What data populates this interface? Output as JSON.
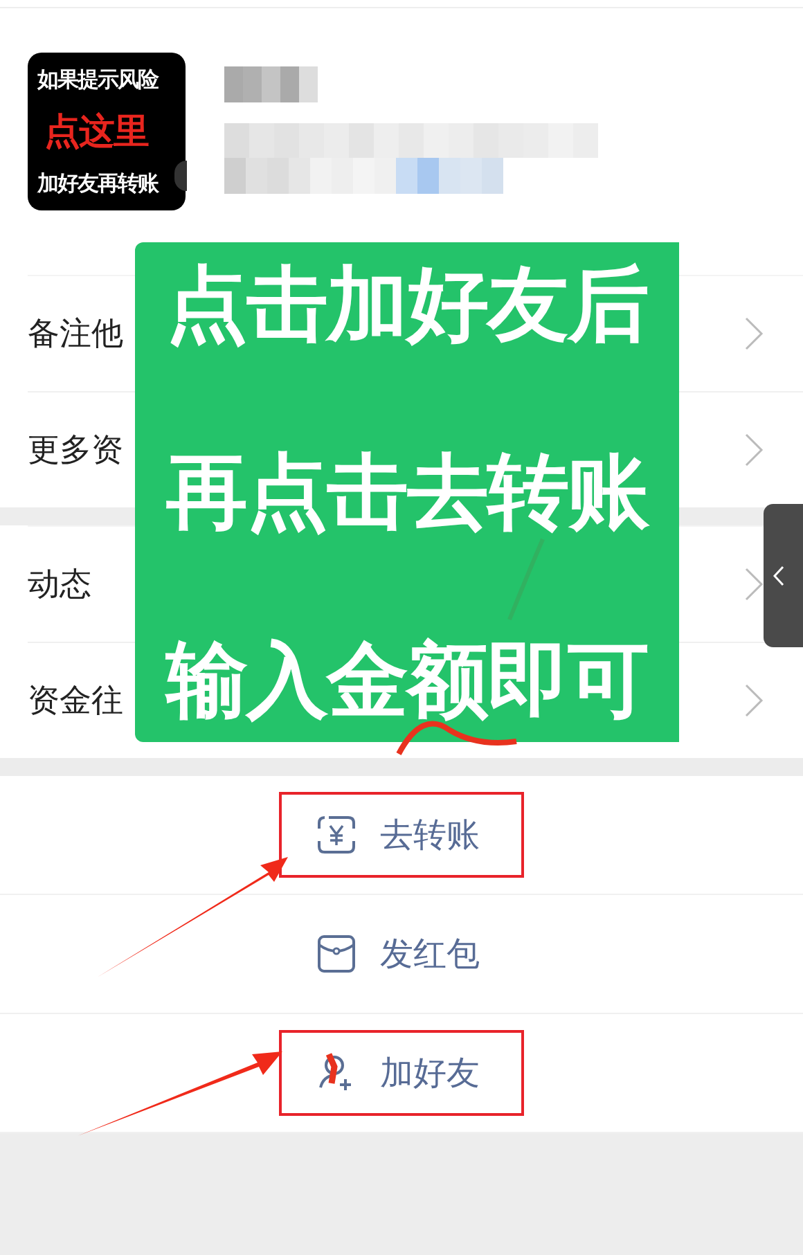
{
  "avatar_badge": {
    "lines": [
      {
        "text": "如果提示风险",
        "kind": "plain"
      },
      {
        "text": "点这里",
        "kind": "highlight"
      },
      {
        "text": "加好友再转账",
        "kind": "plain"
      }
    ]
  },
  "menu_groups": [
    [
      {
        "label": "备注他"
      },
      {
        "label": "更多资"
      }
    ],
    [
      {
        "label": "动态"
      },
      {
        "label": "资金往"
      }
    ]
  ],
  "overlay_note": {
    "lines": [
      "点击加好友后",
      "再点击去转账",
      "输入金额即可"
    ]
  },
  "actions": [
    {
      "label": "去转账",
      "kind": "transfer",
      "highlighted": true
    },
    {
      "label": "发红包",
      "kind": "red-packet",
      "highlighted": false
    },
    {
      "label": "加好友",
      "kind": "add-friend",
      "highlighted": true
    }
  ]
}
